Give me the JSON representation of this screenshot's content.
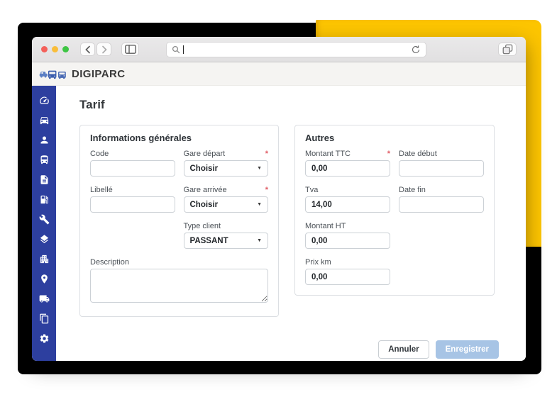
{
  "app": {
    "brand": "DIGIPARC",
    "page_title": "Tarif"
  },
  "ui": {
    "required_marker": "*",
    "select_caret": "▼"
  },
  "sidebar": {
    "icon_names": [
      "dashboard",
      "car",
      "user",
      "bus-driver",
      "document",
      "fuel-pump",
      "wrench",
      "layers",
      "building",
      "map-pin",
      "truck",
      "copy-documents",
      "settings"
    ],
    "bg_color": "#2d3f9f"
  },
  "panels": {
    "general": {
      "title": "Informations générales",
      "code_label": "Code",
      "code_value": "",
      "gare_depart_label": "Gare départ",
      "gare_depart_value": "Choisir",
      "libelle_label": "Libellé",
      "libelle_value": "",
      "gare_arrivee_label": "Gare arrivée",
      "gare_arrivee_value": "Choisir",
      "type_client_label": "Type client",
      "type_client_value": "PASSANT",
      "description_label": "Description",
      "description_value": ""
    },
    "autres": {
      "title": "Autres",
      "montant_ttc_label": "Montant TTC",
      "montant_ttc_value": "0,00",
      "date_debut_label": "Date début",
      "date_debut_value": "",
      "tva_label": "Tva",
      "tva_value": "14,00",
      "date_fin_label": "Date fin",
      "date_fin_value": "",
      "montant_ht_label": "Montant HT",
      "montant_ht_value": "0,00",
      "prix_km_label": "Prix km",
      "prix_km_value": "0,00"
    }
  },
  "actions": {
    "cancel": "Annuler",
    "save": "Enregistrer"
  },
  "colors": {
    "sidebar_blue": "#2d3f9f",
    "accent_yellow": "#fdc500",
    "decor_black": "#000000",
    "required_red": "#e05c65",
    "save_button_blue": "#a7c4e5",
    "brand_icon_blue": "#3f61af"
  }
}
